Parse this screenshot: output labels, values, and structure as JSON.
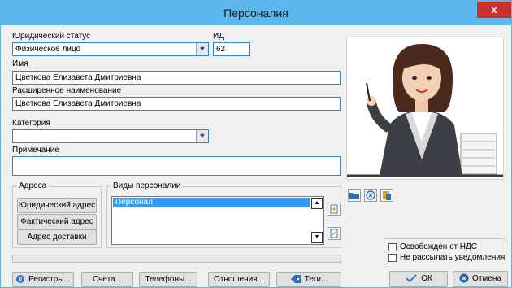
{
  "window": {
    "title": "Персоналия",
    "close_glyph": "x"
  },
  "form": {
    "legal_status_label": "Юридический статус",
    "legal_status_value": "Физическое лицо",
    "id_label": "ИД",
    "id_value": "62",
    "name_label": "Имя",
    "name_value": "Цветкова Елизавета Дмитриевна",
    "full_name_label": "Расширенное наименование",
    "full_name_value": "Цветкова Елизавета Дмитриевна",
    "category_label": "Категория",
    "category_value": "",
    "note_label": "Примечание",
    "note_value": ""
  },
  "addresses": {
    "title": "Адреса",
    "legal_button": "Юридический адрес",
    "actual_button": "Фактический адрес",
    "delivery_button": "Адрес доставки"
  },
  "personalia_types": {
    "title": "Виды персоналии",
    "items": [
      "Персонал"
    ]
  },
  "options": {
    "vat_exempt": "Освобожден от НДС",
    "no_notifications": "Не рассылать уведомления"
  },
  "bottom_buttons": {
    "registers": "Регистры...",
    "accounts": "Счета...",
    "phones": "Телефоны...",
    "relations": "Отношения...",
    "tags": "Теги..."
  },
  "dialog_buttons": {
    "ok": "ОК",
    "cancel": "Отмена"
  },
  "colors": {
    "titlebar": "#5cb8ec",
    "field_border": "#2f86c8",
    "selection": "#3399ff",
    "close": "#c9302c",
    "ok_check": "#2a7fd0",
    "cancel_icon": "#1f5fb0"
  },
  "icons": {
    "registers": "registers-icon",
    "tags": "tag-icon",
    "ok": "checkmark-icon",
    "cancel": "cancel-icon",
    "photo_open": "folder-icon",
    "photo_clear": "clear-icon",
    "photo_paste": "paste-icon",
    "list_add": "add-item-icon",
    "list_edit": "edit-item-icon"
  }
}
